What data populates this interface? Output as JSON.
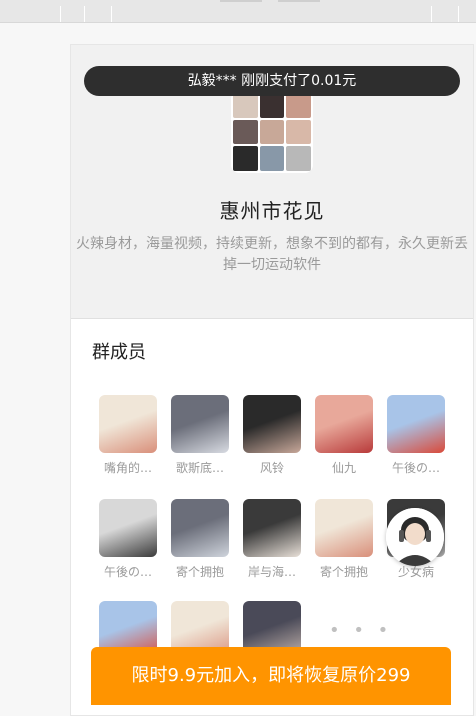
{
  "banner": {
    "text": "弘毅*** 刚刚支付了0.01元"
  },
  "group": {
    "name": "惠州市花见",
    "description": "火辣身材，海量视频，持续更新，想象不到的都有，永久更新丢掉一切运动软件"
  },
  "members": {
    "title": "群成员",
    "items": [
      {
        "name": "嘴角的…",
        "colors": [
          "#f0e6d8",
          "#d98f7a"
        ]
      },
      {
        "name": "歌斯底…",
        "colors": [
          "#6b6e7a",
          "#d8dbe2"
        ]
      },
      {
        "name": "风铃",
        "colors": [
          "#2a2a2a",
          "#c8a89a"
        ]
      },
      {
        "name": "仙九",
        "colors": [
          "#e8a89a",
          "#b83a3a"
        ]
      },
      {
        "name": "午後の…",
        "colors": [
          "#a8c4e8",
          "#d94a3a"
        ]
      },
      {
        "name": "午後の…",
        "colors": [
          "#d8d8d8",
          "#3a3a3a"
        ]
      },
      {
        "name": "寄个拥抱",
        "colors": [
          "#6b6e7a",
          "#cfd4dc"
        ]
      },
      {
        "name": "岸与海…",
        "colors": [
          "#3a3a3a",
          "#e8e0d8"
        ]
      },
      {
        "name": "寄个拥抱",
        "colors": [
          "#f0e6d8",
          "#d98f7a"
        ]
      },
      {
        "name": "少女病",
        "colors": [
          "#3a3a3a",
          "#a8a8a8"
        ]
      },
      {
        "name": "",
        "colors": [
          "#a8c4e8",
          "#d94a3a"
        ]
      },
      {
        "name": "",
        "colors": [
          "#f0e6d8",
          "#d98f7a"
        ]
      },
      {
        "name": "",
        "colors": [
          "#4a4a58",
          "#c8b8b0"
        ]
      }
    ],
    "more": "• • •"
  },
  "join": {
    "label": "限时9.9元加入，即将恢复原价299"
  }
}
